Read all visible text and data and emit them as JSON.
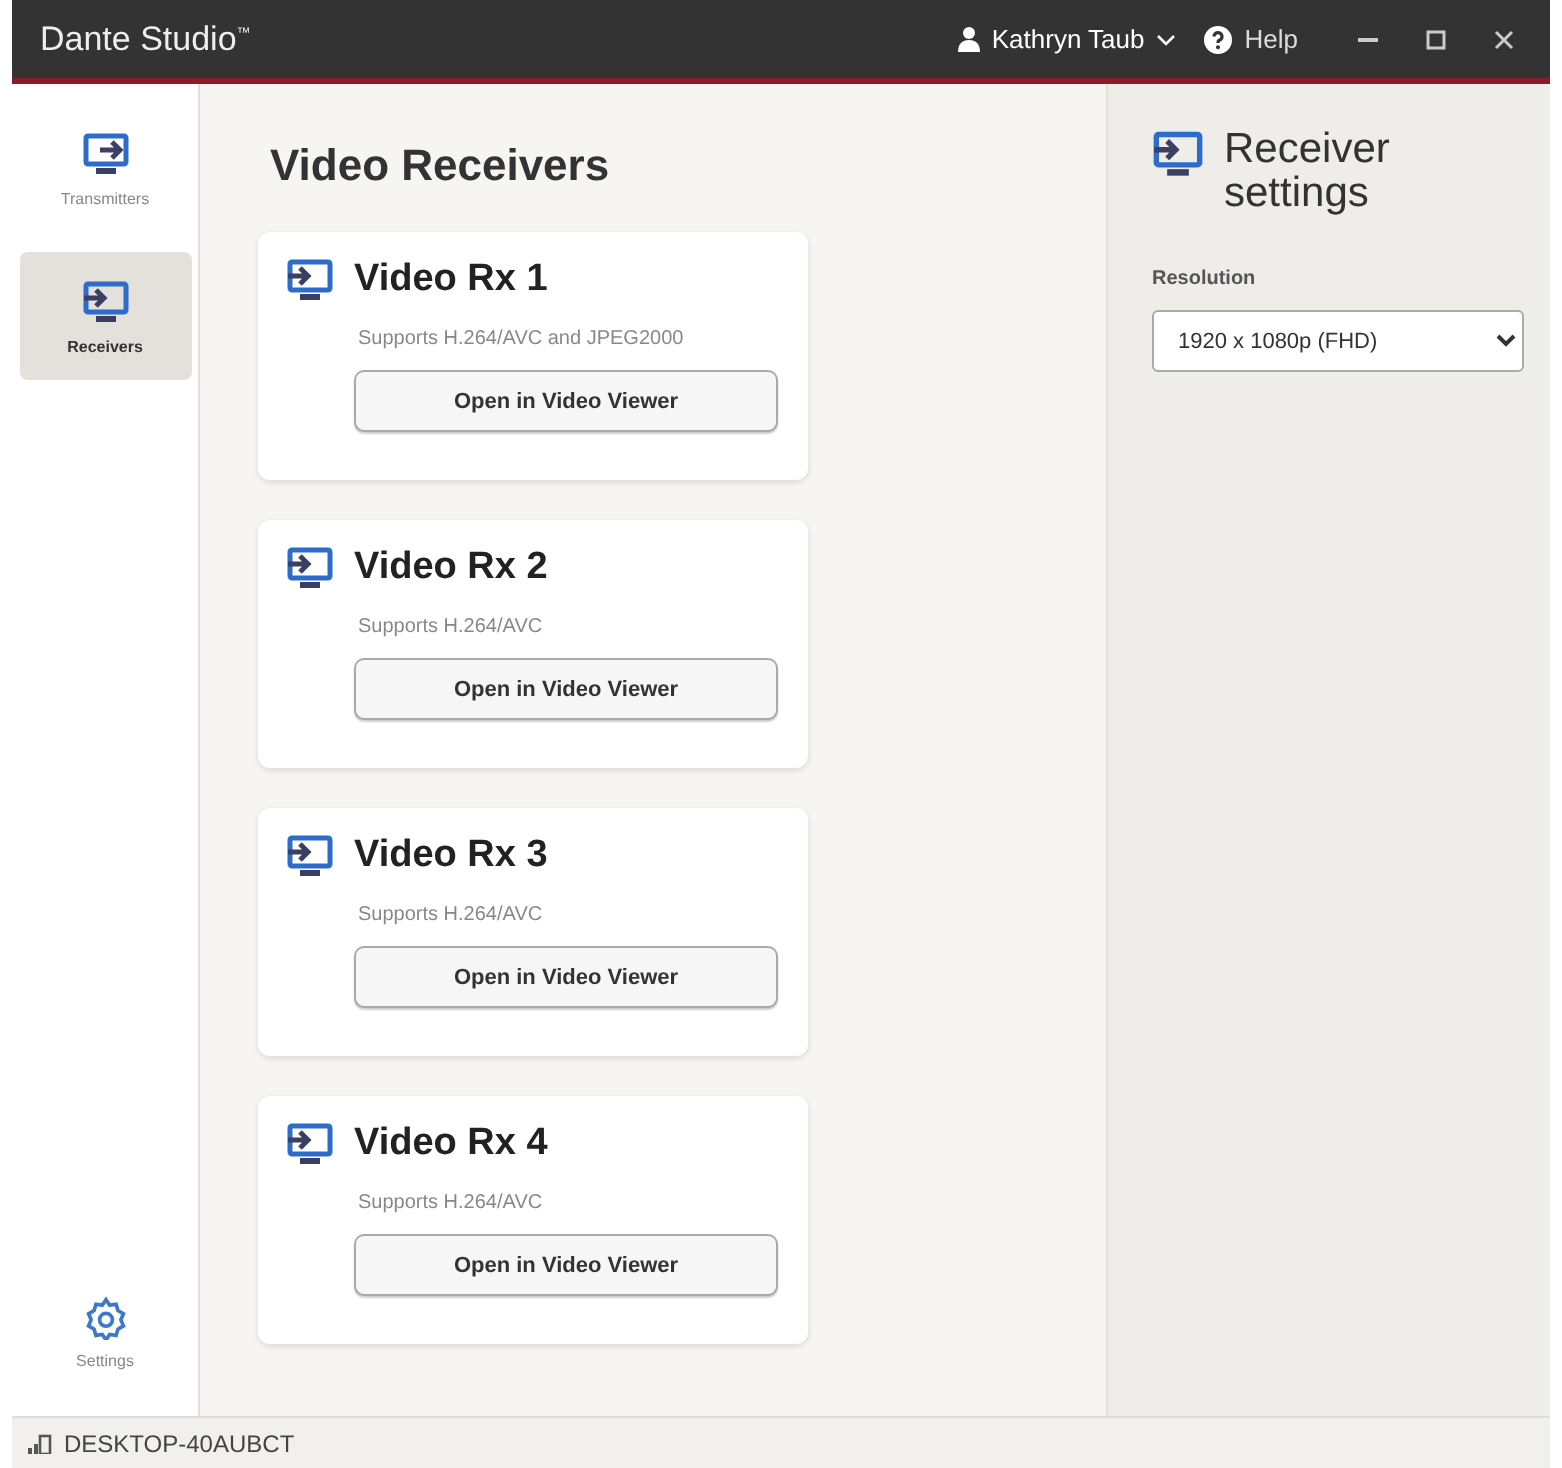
{
  "window": {
    "title": "Dante Studio$^{™}$",
    "user": "Kathryn Taub",
    "help": "Help"
  },
  "sidebar": {
    "items": [
      {
        "label": "Transmitters",
        "selected": false
      },
      {
        "label": "Receivers",
        "selected": true
      }
    ],
    "settings": "Settings"
  },
  "main": {
    "title": "Video Receivers",
    "cards": [
      {
        "name": "Video Rx 1",
        "description": "Supports H.264/AVC and JPEG2000",
        "button": "Open in Video Viewer"
      },
      {
        "name": "Video Rx 2",
        "description": "Supports H.264/AVC",
        "button": "Open in Video Viewer"
      },
      {
        "name": "Video Rx 3",
        "description": "Supports H.264/AVC",
        "button": "Open in Video Viewer"
      },
      {
        "name": "Video Rx 4",
        "description": "Supports H.264/AVC",
        "button": "Open in Video Viewer"
      }
    ]
  },
  "settings_panel": {
    "title": "Receiver settings",
    "field_label": "Resolution",
    "value": "1920 x 1080p (FHD)"
  },
  "status_bar": {
    "host": "DESKTOP-40AUBCT"
  }
}
